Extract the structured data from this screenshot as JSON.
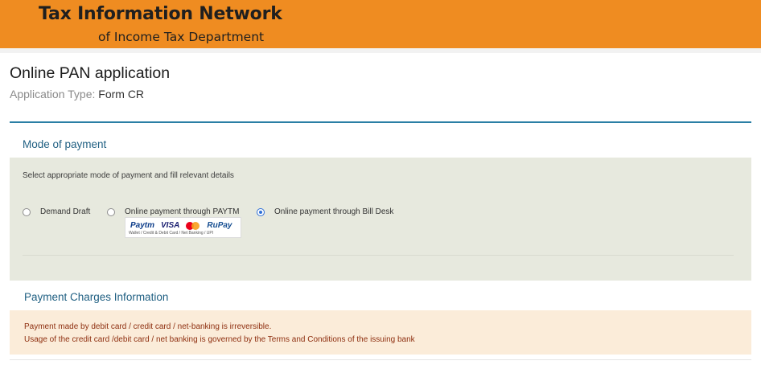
{
  "header": {
    "title": "Tax Information Network",
    "subtitle": "of Income Tax Department",
    "accent_color": "#ef8c21"
  },
  "page": {
    "title": "Online PAN application",
    "application_type_label": "Application Type:",
    "application_type_value": "Form CR"
  },
  "payment": {
    "section_title": "Mode of payment",
    "instruction": "Select appropriate mode of payment and fill relevant details",
    "options": [
      {
        "label": "Demand Draft",
        "selected": false
      },
      {
        "label": "Online payment through PAYTM",
        "selected": false
      },
      {
        "label": "Online payment through Bill Desk",
        "selected": true
      }
    ],
    "logos": {
      "paytm": "Paytm",
      "visa": "VISA",
      "mastercard_icon": "mastercard-icon",
      "rupay": "RuPay",
      "caption": "Wallet / Credit & Debit Card / Net Banking / UPI"
    }
  },
  "charges": {
    "section_title": "Payment Charges Information",
    "lines": [
      "Payment made by debit card / credit card / net-banking is irreversible.",
      "Usage of the credit card /debit card / net banking is governed by the Terms and Conditions of the issuing bank"
    ]
  }
}
